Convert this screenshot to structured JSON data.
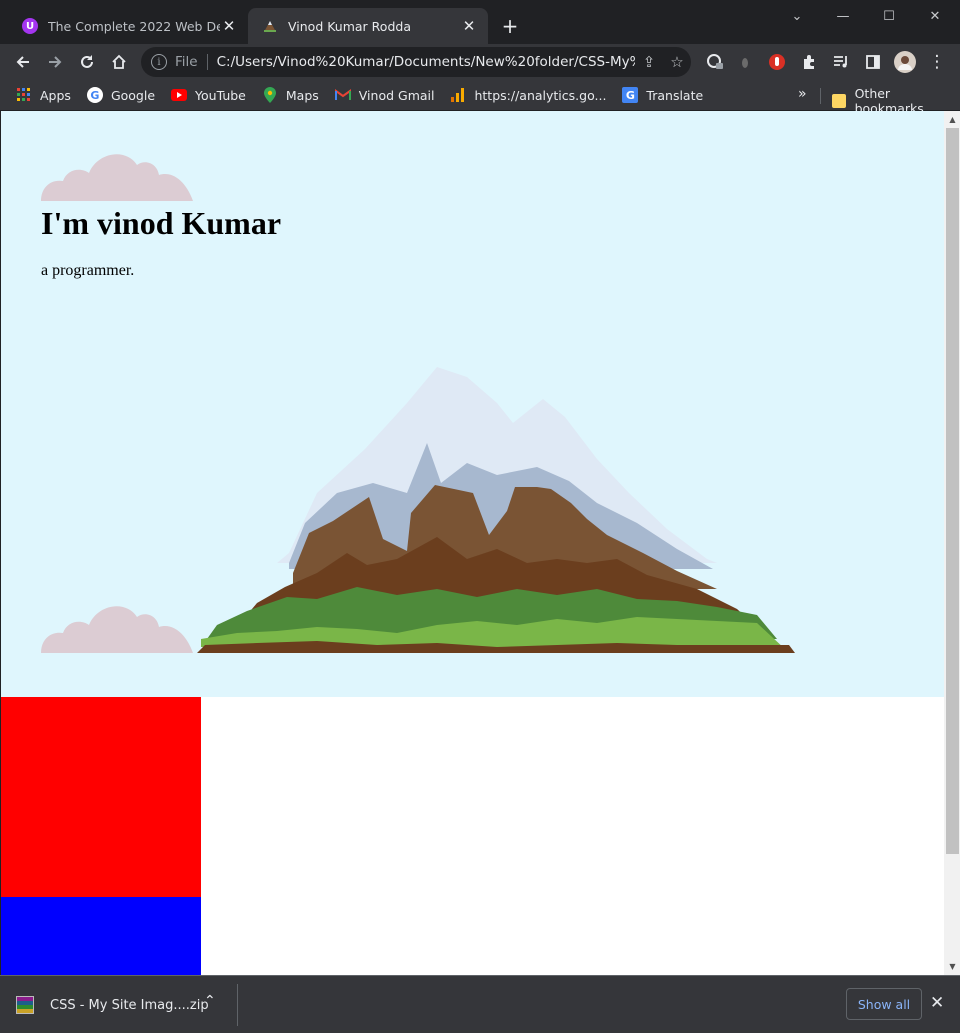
{
  "tabs": [
    {
      "title": "The Complete 2022 Web Developer",
      "favicon": "udemy-icon"
    },
    {
      "title": "Vinod Kumar Rodda",
      "favicon": "mountain-icon"
    }
  ],
  "toolbar": {
    "scheme": "File",
    "url": "C:/Users/Vinod%20Kumar/Documents/New%20folder/CSS-My%..."
  },
  "bookmarks": [
    {
      "label": "Apps",
      "icon": "apps-grid-icon"
    },
    {
      "label": "Google",
      "icon": "google-icon"
    },
    {
      "label": "YouTube",
      "icon": "youtube-icon"
    },
    {
      "label": "Maps",
      "icon": "maps-pin-icon"
    },
    {
      "label": "Vinod Gmail",
      "icon": "gmail-icon"
    },
    {
      "label": "https://analytics.go...",
      "icon": "analytics-icon"
    },
    {
      "label": "Translate",
      "icon": "translate-icon"
    }
  ],
  "bookmarks_overflow": "»",
  "other_bookmarks": "Other bookmarks",
  "page": {
    "heading": "I'm vinod Kumar",
    "subtitle": "a programmer.",
    "colors": {
      "hero_bg": "#dff6fd",
      "box1": "#ff0000",
      "box2": "#0000ff",
      "cloud": "#dcccd3"
    }
  },
  "downloads": {
    "file": "CSS - My Site Imag....zip",
    "show_all": "Show all"
  }
}
